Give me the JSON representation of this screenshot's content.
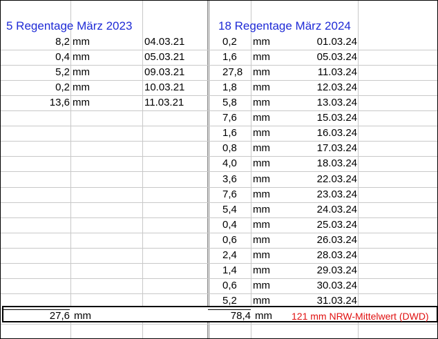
{
  "left_block": {
    "title": "5 Regentage März 2023",
    "rows": [
      {
        "value": "8,2",
        "unit": "mm",
        "date": "04.03.21"
      },
      {
        "value": "0,4",
        "unit": "mm",
        "date": "05.03.21"
      },
      {
        "value": "5,2",
        "unit": "mm",
        "date": "09.03.21"
      },
      {
        "value": "0,2",
        "unit": "mm",
        "date": "10.03.21"
      },
      {
        "value": "13,6",
        "unit": "mm",
        "date": "11.03.21"
      }
    ],
    "total": {
      "value": "27,6",
      "unit": "mm"
    }
  },
  "right_block": {
    "title": "18 Regentage März 2024",
    "rows": [
      {
        "value": "0,2",
        "unit": "mm",
        "date": "01.03.24"
      },
      {
        "value": "1,6",
        "unit": "mm",
        "date": "05.03.24"
      },
      {
        "value": "27,8",
        "unit": "mm",
        "date": "11.03.24"
      },
      {
        "value": "1,8",
        "unit": "mm",
        "date": "12.03.24"
      },
      {
        "value": "5,8",
        "unit": "mm",
        "date": "13.03.24"
      },
      {
        "value": "7,6",
        "unit": "mm",
        "date": "15.03.24"
      },
      {
        "value": "1,6",
        "unit": "mm",
        "date": "16.03.24"
      },
      {
        "value": "0,8",
        "unit": "mm",
        "date": "17.03.24"
      },
      {
        "value": "4,0",
        "unit": "mm",
        "date": "18.03.24"
      },
      {
        "value": "3,6",
        "unit": "mm",
        "date": "22.03.24"
      },
      {
        "value": "7,6",
        "unit": "mm",
        "date": "23.03.24"
      },
      {
        "value": "5,4",
        "unit": "mm",
        "date": "24.03.24"
      },
      {
        "value": "0,4",
        "unit": "mm",
        "date": "25.03.24"
      },
      {
        "value": "0,6",
        "unit": "mm",
        "date": "26.03.24"
      },
      {
        "value": "2,4",
        "unit": "mm",
        "date": "28.03.24"
      },
      {
        "value": "1,4",
        "unit": "mm",
        "date": "29.03.24"
      },
      {
        "value": "0,6",
        "unit": "mm",
        "date": "30.03.24"
      },
      {
        "value": "5,2",
        "unit": "mm",
        "date": "31.03.24"
      }
    ],
    "total": {
      "value": "78,4",
      "unit": "mm"
    }
  },
  "note": "121 mm NRW-Mittelwert (DWD)",
  "colors": {
    "title": "#1f2bd6",
    "note": "#e01010",
    "grid": "#c8c8c8"
  }
}
